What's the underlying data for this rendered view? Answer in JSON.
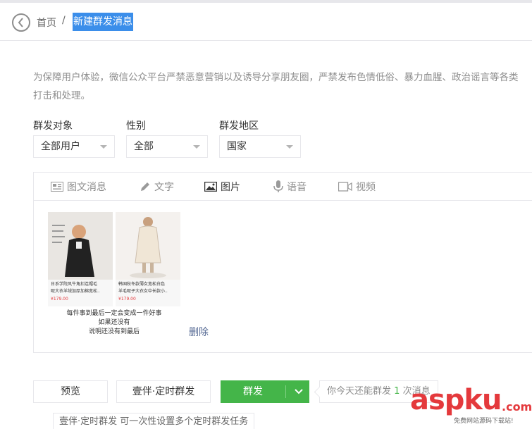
{
  "breadcrumb": {
    "home": "首页",
    "separator": "/",
    "current": "新建群发消息"
  },
  "notice": {
    "line1": "为保障用户体验，微信公众平台严禁恶意营销以及诱导分享朋友圈，严禁发布色情低俗、暴力血腥、政治谣言等各类",
    "line2": "打击和处理。"
  },
  "filters": [
    {
      "label": "群发对象",
      "value": "全部用户"
    },
    {
      "label": "性别",
      "value": "全部"
    },
    {
      "label": "群发地区",
      "value": "国家"
    }
  ],
  "tabs": [
    {
      "label": "图文消息",
      "icon": "news-icon",
      "active": false
    },
    {
      "label": "文字",
      "icon": "pencil-icon",
      "active": false
    },
    {
      "label": "图片",
      "icon": "image-icon",
      "active": true
    },
    {
      "label": "语音",
      "icon": "microphone-icon",
      "active": false
    },
    {
      "label": "视频",
      "icon": "video-icon",
      "active": false
    }
  ],
  "image_preview": {
    "card1": {
      "caption1": "日系学院风牛角扣连帽毛",
      "caption2": "呢大衣羊绒加厚加棉宽松..",
      "price": "¥179.00"
    },
    "card2": {
      "caption1": "韩国秋冬款薄女宽松白色",
      "caption2": "羊毛呢子大衣女中长款小..",
      "price": "¥179.00"
    },
    "poem": [
      "每件事到最后一定会变成一件好事",
      "如果还没有",
      "说明还没有到最后"
    ]
  },
  "actions": {
    "delete": "删除",
    "preview": "预览",
    "scheduled": "壹伴·定时群发",
    "send": "群发"
  },
  "tip": {
    "prefix": "你今天还能群发",
    "count": "1",
    "suffix": "次消息"
  },
  "tooltip": "壹伴·定时群发 可一次性设置多个定时群发任务",
  "watermark": {
    "brand": "aspku",
    "tld": ".com",
    "sub": "免费网站源码下载站!"
  },
  "colors": {
    "accent_green": "#44b549",
    "link_blue": "#576b95",
    "highlight": "#3b8eea",
    "watermark_red": "#e4393c"
  }
}
